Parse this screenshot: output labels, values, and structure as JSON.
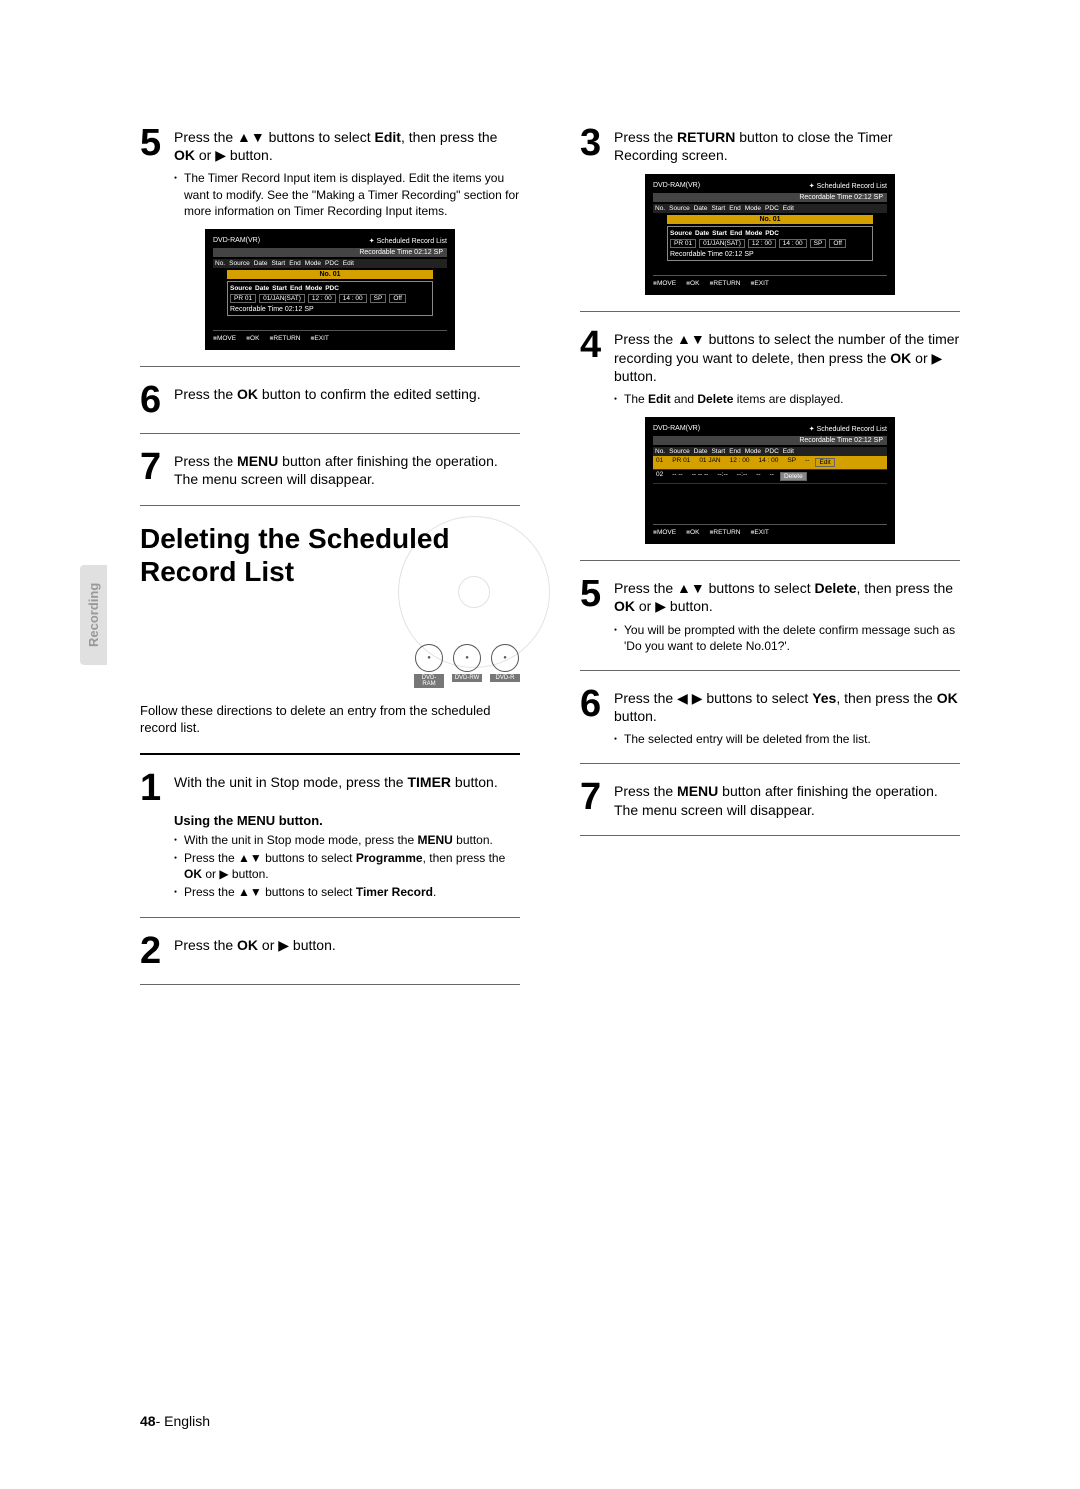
{
  "sideTab": "Recording",
  "left": {
    "step5": {
      "text_a": "Press the ",
      "text_b": " buttons to select ",
      "bold1": "Edit",
      "text_c": ", then press the ",
      "bold2": "OK",
      "text_d": " or ",
      "text_e": " button.",
      "bullets": [
        "The Timer Record Input item is displayed. Edit the items you want to modify. See the \"Making a Timer Recording\" section for more information on Timer Recording Input items."
      ]
    },
    "step6": {
      "text_a": "Press the ",
      "bold1": "OK",
      "text_b": " button to confirm the edited setting."
    },
    "step7": {
      "text_a": "Press the ",
      "bold1": "MENU",
      "text_b": " button after finishing the operation.",
      "sub": "The menu screen will disappear."
    },
    "heading": "Deleting the Scheduled Record List",
    "discIcons": [
      "DVD-RAM",
      "DVD-RW",
      "DVD-R"
    ],
    "intro": "Follow these directions to delete an entry from the scheduled record list.",
    "step1": {
      "text_a": "With the unit in Stop mode, press the ",
      "bold1": "TIMER",
      "text_b": " button."
    },
    "menuSubhead": "Using the MENU button.",
    "menuBullets_1_a": "With the unit in Stop mode mode, press the ",
    "menuBullets_1_b": "MENU",
    "menuBullets_1_c": " button.",
    "menuBullets_2_a": "Press the ",
    "menuBullets_2_b": " buttons to select ",
    "menuBullets_2_c": "Programme",
    "menuBullets_2_d": ", then press the ",
    "menuBullets_2_e": "OK",
    "menuBullets_2_f": " or  ",
    "menuBullets_2_g": " button.",
    "menuBullets_3_a": "Press the ",
    "menuBullets_3_b": " buttons to select ",
    "menuBullets_3_c": "Timer Record",
    "menuBullets_3_d": ".",
    "step2": {
      "text_a": "Press the ",
      "bold1": "OK",
      "text_b": " or ",
      "text_c": " button."
    }
  },
  "right": {
    "step3": {
      "text_a": "Press the ",
      "bold1": "RETURN",
      "text_b": " button to close the Timer Recording screen."
    },
    "step4": {
      "text_a": "Press the ",
      "text_b": " buttons to select the number of the timer recording you want to delete, then press the ",
      "bold1": "OK",
      "text_c": " or ",
      "text_d": " button.",
      "bullets_a": "The ",
      "bullets_b": "Edit",
      "bullets_c": " and ",
      "bullets_d": "Delete",
      "bullets_e": " items are displayed."
    },
    "step5": {
      "text_a": "Press the ",
      "text_b": " buttons to select ",
      "bold1": "Delete",
      "text_c": ", then press the ",
      "bold2": "OK",
      "text_d": " or ",
      "text_e": " button.",
      "bullets": [
        "You will be prompted with the delete confirm message such as 'Do you want to delete No.01?'."
      ]
    },
    "step6": {
      "text_a": "Press the ",
      "text_b": " buttons to select ",
      "bold1": "Yes",
      "text_c": ", then press the ",
      "bold2": "OK",
      "text_d": " button.",
      "bullets": [
        "The selected entry will be deleted from the list."
      ]
    },
    "step7": {
      "text_a": "Press the ",
      "bold1": "MENU",
      "text_b": " button after finishing the operation.",
      "sub": "The menu screen will disappear."
    }
  },
  "osd": {
    "title_left": "DVD-RAM(VR)",
    "title_right": "Scheduled Record List",
    "recordable": "Recordable Time 02:12 SP",
    "headerRow": [
      "No.",
      "Source",
      "Date",
      "Start",
      "End",
      "Mode",
      "PDC",
      "Edit"
    ],
    "no01": "No. 01",
    "boxHeader": [
      "Source",
      "Date",
      "Start",
      "End",
      "Mode",
      "PDC"
    ],
    "boxRow": [
      "PR 01",
      "01/JAN(SAT)",
      "12 : 00",
      "14 : 00",
      "SP",
      "Off"
    ],
    "boxFooter": "Recordable Time 02:12 SP",
    "foot": [
      "MOVE",
      "OK",
      "RETURN",
      "EXIT"
    ],
    "listRow1": [
      "01",
      "PR 01",
      "01 JAN",
      "12 : 00",
      "14 : 00",
      "SP",
      "--"
    ],
    "listRow2": [
      "02",
      "-- --",
      "-- -- --",
      "--:--",
      "--:--",
      "--",
      "--"
    ],
    "editBtn": "Edit",
    "deleteBtn": "Delete"
  },
  "footer": {
    "page": "48",
    "lang": "- English"
  }
}
